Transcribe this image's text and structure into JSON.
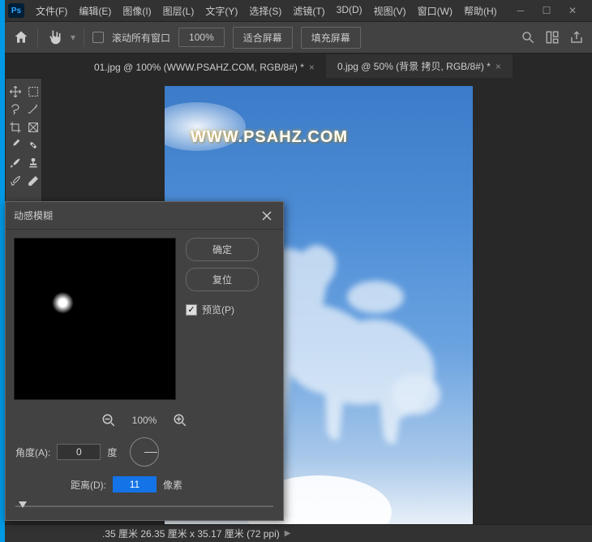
{
  "app": {
    "logo": "Ps"
  },
  "menu": [
    "文件(F)",
    "编辑(E)",
    "图像(I)",
    "图层(L)",
    "文字(Y)",
    "选择(S)",
    "滤镜(T)",
    "3D(D)",
    "视图(V)",
    "窗口(W)",
    "帮助(H)"
  ],
  "optionsBar": {
    "scrollAll": "滚动所有窗口",
    "zoom": "100%",
    "fitScreen": "适合屏幕",
    "fillScreen": "填充屏幕"
  },
  "tabs": [
    {
      "label": "01.jpg @ 100% (WWW.PSAHZ.COM, RGB/8#) *",
      "active": false
    },
    {
      "label": "0.jpg @ 50% (背景 拷贝, RGB/8#) *",
      "active": true
    }
  ],
  "canvas": {
    "watermark": "WWW.PSAHZ.COM"
  },
  "statusbar": {
    "text": ".35 厘米   26.35 厘米 x 35.17 厘米 (72 ppi)",
    "arrow": "▶"
  },
  "dialog": {
    "title": "动感模糊",
    "ok": "确定",
    "reset": "复位",
    "previewLabel": "预览(P)",
    "zoomLevel": "100%",
    "angleLabel": "角度(A):",
    "angleValue": "0",
    "angleUnit": "度",
    "distLabel": "距离(D):",
    "distValue": "11",
    "distUnit": "像素"
  },
  "icons": {
    "home": "home",
    "hand": "hand",
    "search": "search",
    "grid": "grid",
    "share": "share",
    "move": "move",
    "marquee": "marquee",
    "lasso": "lasso",
    "wand": "wand",
    "crop": "crop",
    "frame": "frame",
    "eyedrop": "eyedrop",
    "heal": "heal",
    "brush": "brush",
    "stamp": "stamp",
    "eraser": "eraser",
    "history": "history"
  }
}
